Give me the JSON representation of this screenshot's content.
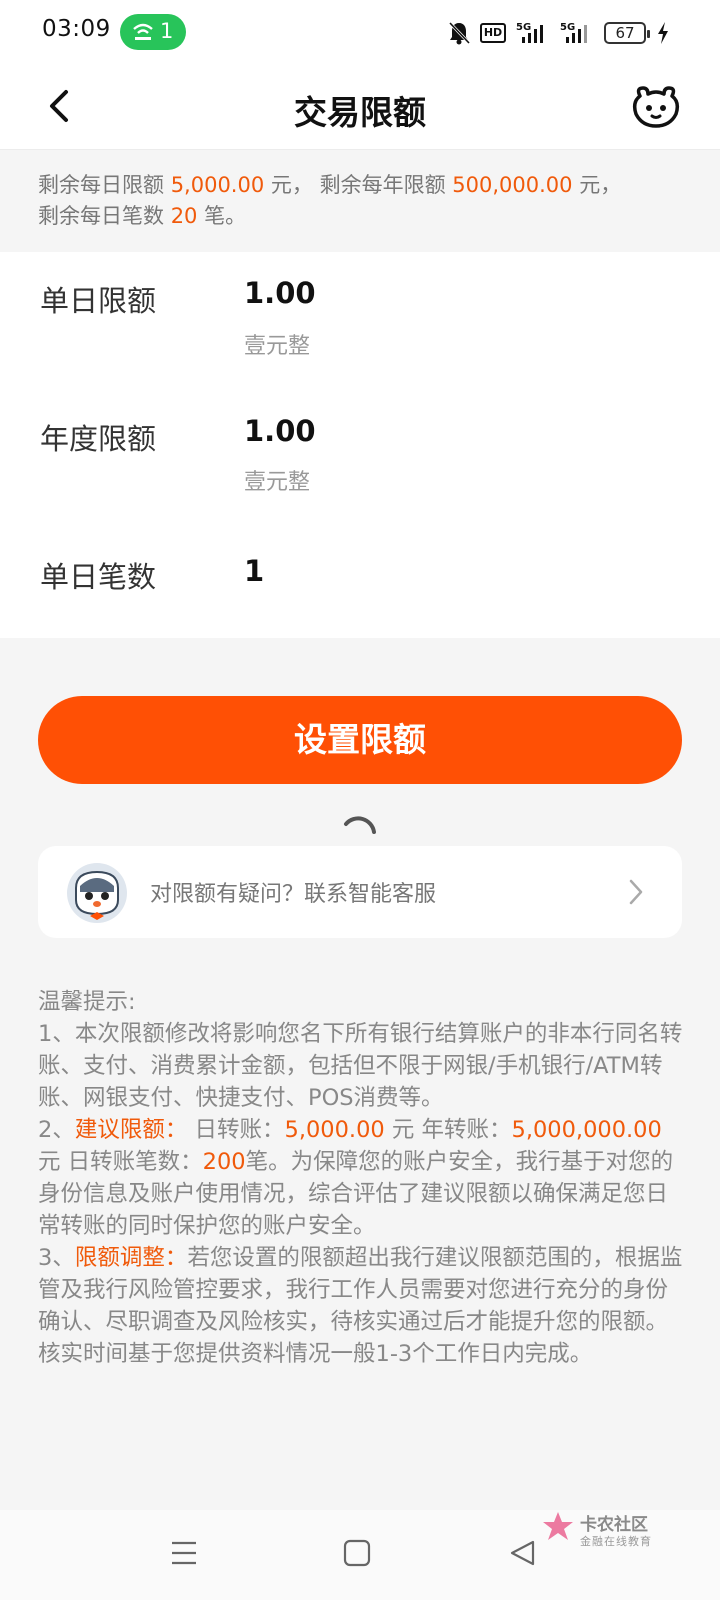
{
  "status_bar": {
    "time": "03:09",
    "hotspot_count": "1",
    "hd_label": "HD",
    "battery": "67",
    "icons": [
      "wifi-hotspot-icon",
      "mute-icon",
      "hd-icon",
      "signal-5g-icon",
      "signal-5g-icon",
      "battery-icon",
      "charging-icon"
    ]
  },
  "header": {
    "title": "交易限额",
    "back_icon": "chevron-left-icon",
    "service_icon": "customer-service-icon"
  },
  "notice": {
    "daily_prefix": "剩余每日限额",
    "daily_amount": "5,000.00",
    "daily_unit": "元，",
    "yearly_prefix": "剩余每年限额",
    "yearly_amount": "500,000.00",
    "yearly_unit": "元，",
    "count_prefix": "剩余每日笔数",
    "count_value": "20",
    "count_unit": "笔。"
  },
  "form": {
    "daily_limit": {
      "label": "单日限额",
      "value": "1.00",
      "words": "壹元整"
    },
    "annual_limit": {
      "label": "年度限额",
      "value": "1.00",
      "words": "壹元整"
    },
    "daily_count": {
      "label": "单日笔数",
      "value": "1"
    }
  },
  "submit": {
    "label": "设置限额"
  },
  "service_card": {
    "text": "对限额有疑问？联系智能客服"
  },
  "tips": {
    "title": "温馨提示:",
    "item1": "1、本次限额修改将影响您名下所有银行结算账户的非本行同名转账、支付、消费累计金额，包括但不限于网银/手机银行/ATM转账、网银支付、快捷支付、POS消费等。",
    "item2_prefix": "2、",
    "item2_highlight": "建议限额：",
    "item2_day_label": " 日转账：",
    "item2_day_amount": "5,000.00",
    "item2_year_label": " 元 年转账：",
    "item2_year_amount": "5,000,000.00",
    "item2_count_label": " 元 日转账笔数：",
    "item2_count_value": "200",
    "item2_rest": "笔。为保障您的账户安全，我行基于对您的身份信息及账户使用情况，综合评估了建议限额以确保满足您日常转账的同时保护您的账户安全。",
    "item3_prefix": "3、",
    "item3_highlight": "限额调整：",
    "item3_rest": "若您设置的限额超出我行建议限额范围的，根据监管及我行风险管控要求，我行工作人员需要对您进行充分的身份确认、尽职调查及风险核实，待核实通过后才能提升您的限额。核实时间基于您提供资料情况一般1-3个工作日内完成。"
  },
  "watermark": {
    "title": "卡农社区",
    "subtitle": "金融在线教育"
  },
  "nav": {
    "icons": [
      "menu-icon",
      "home-icon",
      "back-icon"
    ]
  },
  "colors": {
    "accent": "#ff5005",
    "highlight": "#f05a0b",
    "hotspot_green": "#28c45a"
  }
}
